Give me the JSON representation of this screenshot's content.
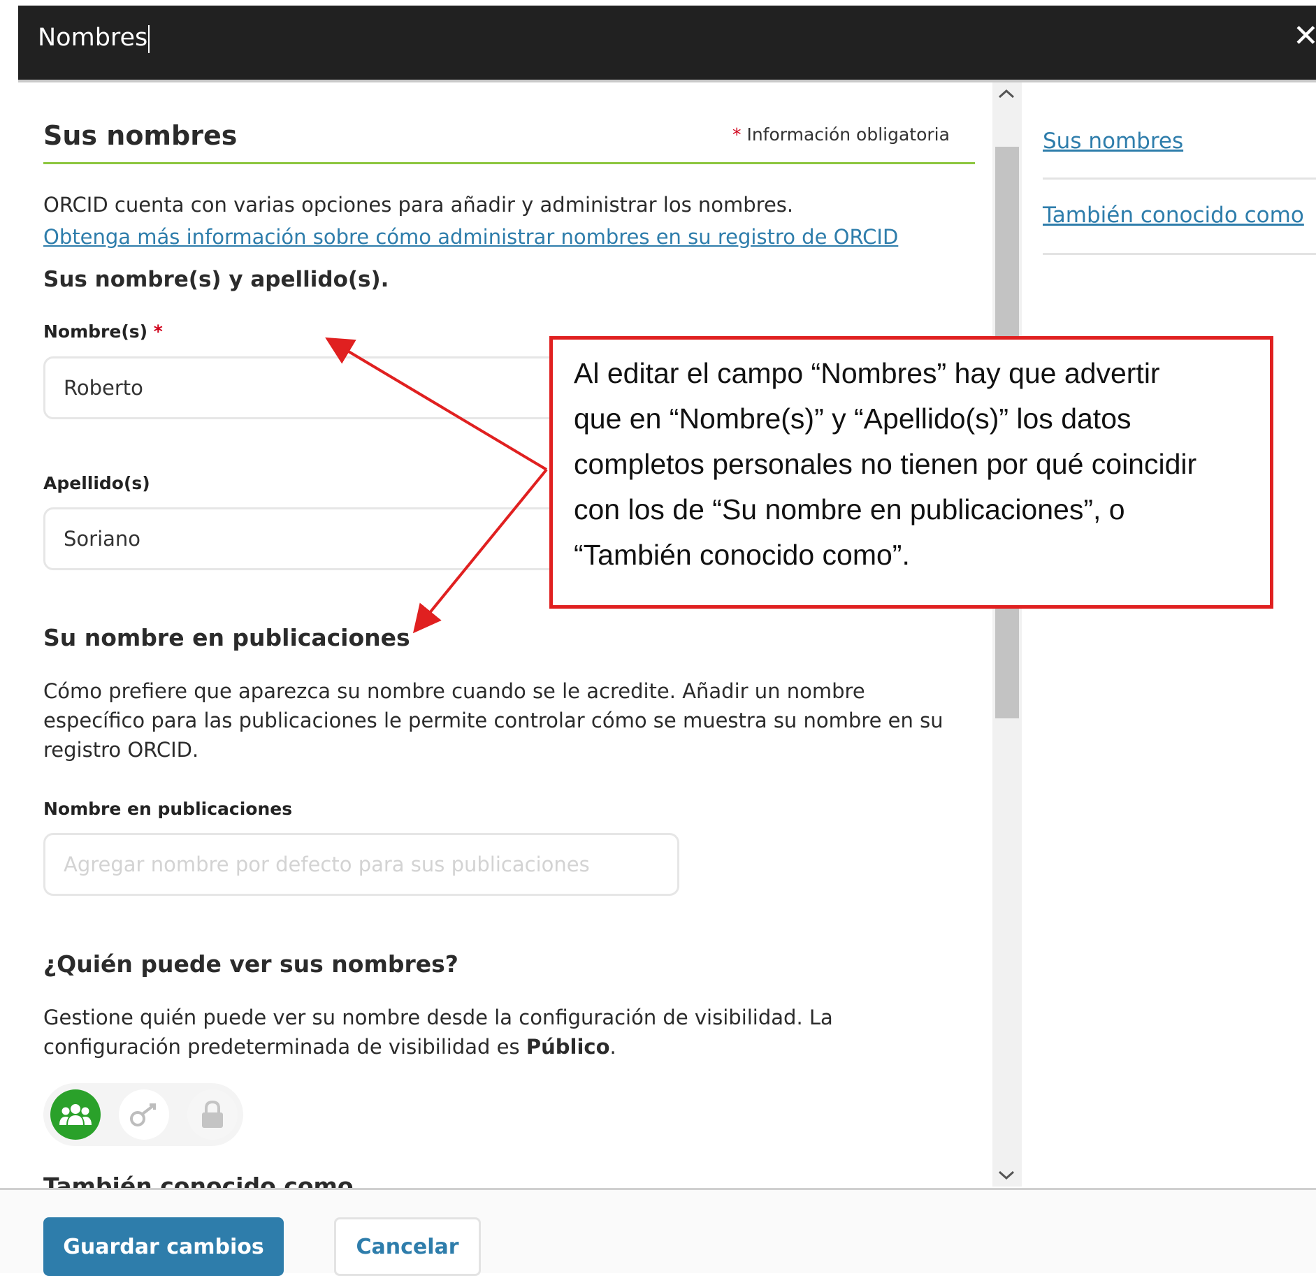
{
  "dialog": {
    "title": "Nombres",
    "close_label": "✕"
  },
  "section": {
    "heading": "Sus nombres",
    "required_star": "*",
    "required_note": "Información obligatoria",
    "intro": "ORCID cuenta con varias opciones para añadir y administrar los nombres.",
    "intro_link": "Obtenga más información sobre cómo administrar nombres en su registro de ORCID",
    "names_heading": "Sus nombre(s) y apellido(s)."
  },
  "fields": {
    "given_label": "Nombre(s)",
    "given_required": "*",
    "given_value": "Roberto",
    "family_label": "Apellido(s)",
    "family_value": "Soriano",
    "published_heading": "Su nombre en publicaciones",
    "published_description": "Cómo prefiere que aparezca su nombre cuando se le acredite. Añadir un nombre específico para las publicaciones le permite controlar cómo se muestra su nombre en su registro ORCID.",
    "published_label": "Nombre en publicaciones",
    "published_placeholder": "Agregar nombre por defecto para sus publicaciones"
  },
  "visibility": {
    "heading": "¿Quién puede ver sus nombres?",
    "text_before": "Gestione quién puede ver su nombre desde la configuración de visibilidad. La configuración predeterminada de visibilidad es ",
    "default_value": "Público",
    "text_after": ".",
    "options": [
      "public-icon",
      "trusted-parties-icon",
      "private-lock-icon"
    ],
    "selected_color": "#2aa12a"
  },
  "next_heading": "También conocido como",
  "side_nav": {
    "items": [
      "Sus nombres",
      "También conocido como"
    ]
  },
  "footer": {
    "save_label": "Guardar cambios",
    "cancel_label": "Cancelar"
  },
  "callout": {
    "lines": [
      "Al editar el campo “Nombres” hay que advertir",
      "que en “Nombre(s)” y “Apellido(s)” los datos",
      "completos personales no tienen por qué coincidir",
      "con los de “Su nombre en publicaciones”, o",
      "“También conocido como”."
    ],
    "border_color": "#e02020"
  },
  "colors": {
    "accent_link": "#2e7dab",
    "heading_underline": "#8dc63f",
    "topbar": "#212121"
  }
}
